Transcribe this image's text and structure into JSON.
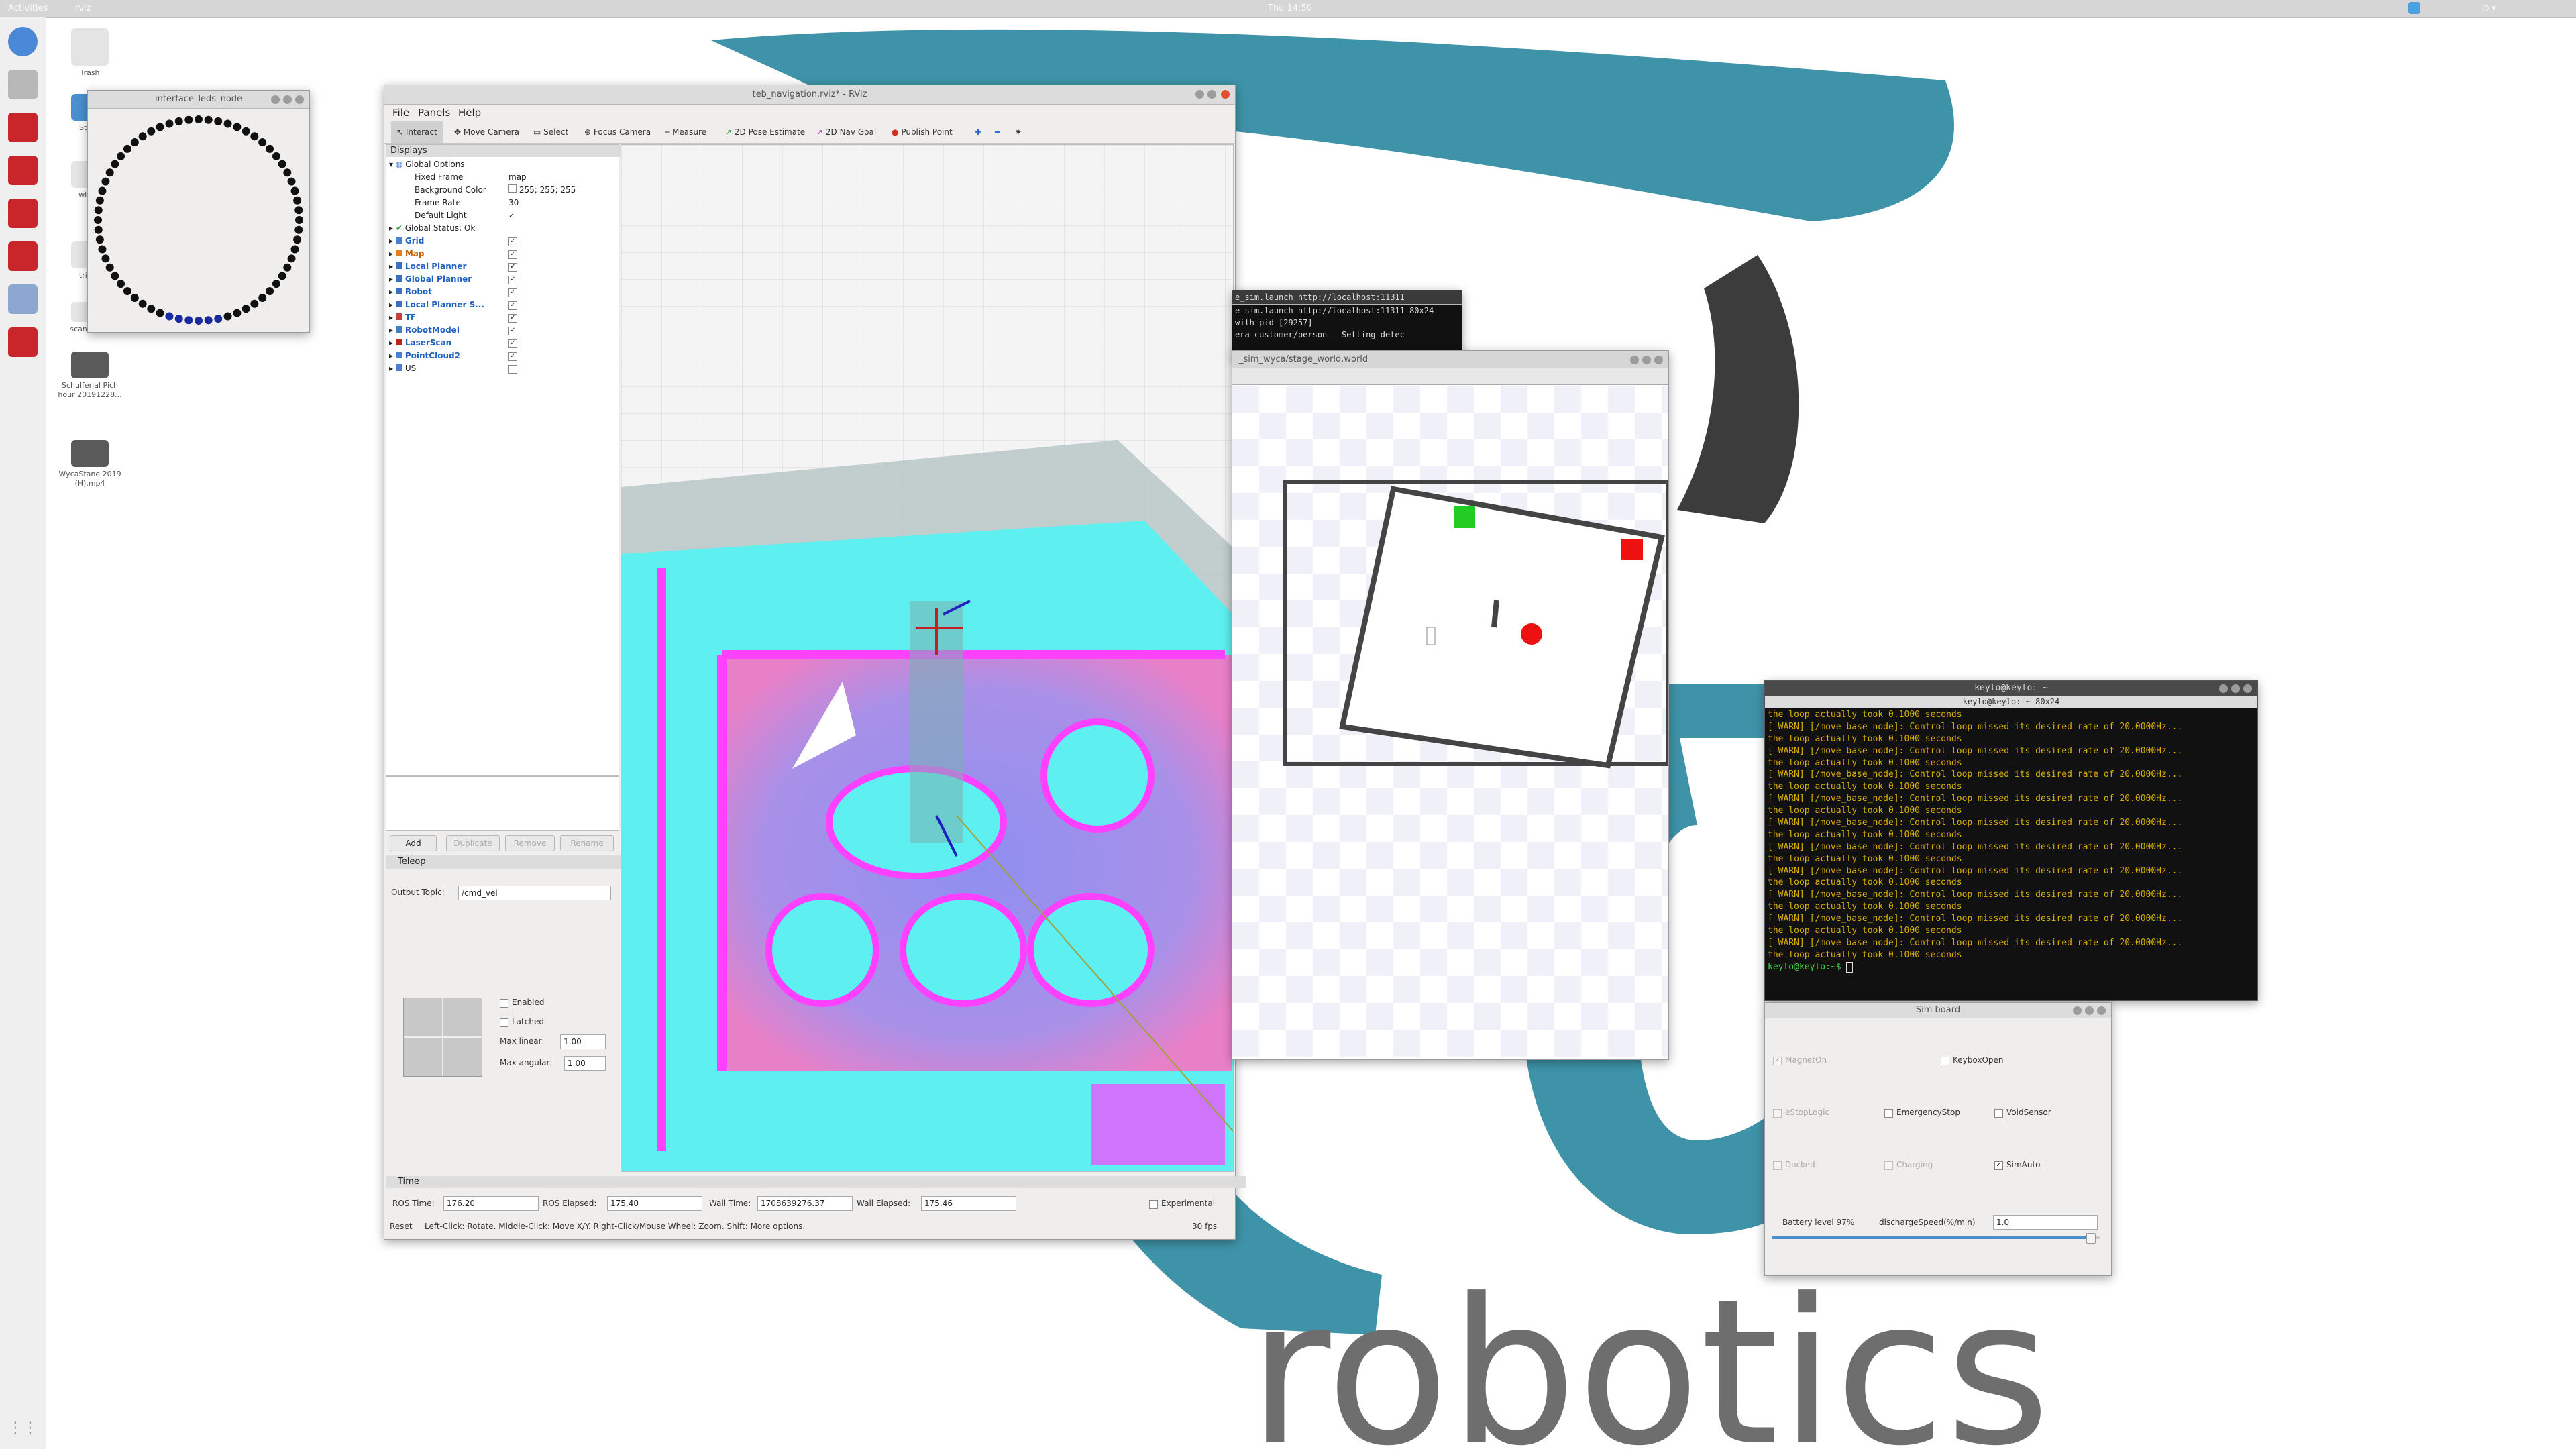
{
  "topbar": {
    "activities": "Activities",
    "app": "rviz",
    "clock": "Thu 14:50"
  },
  "desktop": {
    "icons": [
      {
        "label": "Trash"
      },
      {
        "label": "Star..."
      },
      {
        "label": "with..."
      },
      {
        "label": "trial..."
      },
      {
        "label": "scanlab.py"
      },
      {
        "label": "Schulferial Pich hour 20191228..."
      },
      {
        "label": "WycaStane 2019 (H).mp4"
      }
    ]
  },
  "leds": {
    "title": "interface_leds_node"
  },
  "rviz": {
    "title": "teb_navigation.rviz* - RViz",
    "menus": [
      "File",
      "Panels",
      "Help"
    ],
    "tools": [
      "Interact",
      "Move Camera",
      "Select",
      "Focus Camera",
      "Measure",
      "2D Pose Estimate",
      "2D Nav Goal",
      "Publish Point"
    ],
    "displays_title": "Displays",
    "global_options": "Global Options",
    "props": [
      {
        "name": "Fixed Frame",
        "value": "map"
      },
      {
        "name": "Background Color",
        "value": "255; 255; 255"
      },
      {
        "name": "Frame Rate",
        "value": "30"
      },
      {
        "name": "Default Light",
        "value": "✓"
      }
    ],
    "global_status": "Global Status: Ok",
    "displays": [
      "Grid",
      "Map",
      "Local Planner",
      "Global Planner",
      "Robot",
      "Local Planner S...",
      "TF",
      "RobotModel",
      "LaserScan",
      "PointCloud2",
      "US"
    ],
    "buttons": [
      "Add",
      "Duplicate",
      "Remove",
      "Rename"
    ],
    "teleop": {
      "title": "Teleop",
      "output_topic_label": "Output Topic:",
      "output_topic": "/cmd_vel",
      "enabled": "Enabled",
      "latched": "Latched",
      "max_linear_label": "Max linear:",
      "max_linear": "1.00",
      "max_angular_label": "Max angular:",
      "max_angular": "1.00"
    },
    "time": {
      "title": "Time",
      "ros_time_label": "ROS Time:",
      "ros_time": "176.20",
      "ros_elapsed_label": "ROS Elapsed:",
      "ros_elapsed": "175.40",
      "wall_time_label": "Wall Time:",
      "wall_time": "1708639276.37",
      "wall_elapsed_label": "Wall Elapsed:",
      "wall_elapsed": "175.46",
      "experimental": "Experimental"
    },
    "status": {
      "reset": "Reset",
      "hint": "Left-Click: Rotate. Middle-Click: Move X/Y. Right-Click/Mouse Wheel: Zoom. Shift: More options.",
      "fps": "30 fps"
    }
  },
  "small_term": {
    "title": "e_sim.launch http://localhost:11311",
    "lines": [
      "e_sim.launch http://localhost:11311 80x24",
      "with pid [29257]",
      "era_customer/person - Setting detec"
    ]
  },
  "stage": {
    "title": "_sim_wyca/stage_world.world"
  },
  "terminal": {
    "title": "keylo@keylo: ~",
    "subtitle": "keylo@keylo: ~ 80x24",
    "lines": [
      "the loop actually took 0.1000 seconds",
      "[ WARN] [/move_base_node]: Control loop missed its desired rate of 20.0000Hz...",
      "the loop actually took 0.1000 seconds",
      "[ WARN] [/move_base_node]: Control loop missed its desired rate of 20.0000Hz...",
      "the loop actually took 0.1000 seconds",
      "[ WARN] [/move_base_node]: Control loop missed its desired rate of 20.0000Hz...",
      "the loop actually took 0.1000 seconds",
      "[ WARN] [/move_base_node]: Control loop missed its desired rate of 20.0000Hz...",
      "the loop actually took 0.1000 seconds",
      "[ WARN] [/move_base_node]: Control loop missed its desired rate of 20.0000Hz...",
      "the loop actually took 0.1000 seconds",
      "[ WARN] [/move_base_node]: Control loop missed its desired rate of 20.0000Hz...",
      "the loop actually took 0.1000 seconds",
      "[ WARN] [/move_base_node]: Control loop missed its desired rate of 20.0000Hz...",
      "the loop actually took 0.1000 seconds",
      "[ WARN] [/move_base_node]: Control loop missed its desired rate of 20.0000Hz...",
      "the loop actually took 0.1000 seconds",
      "[ WARN] [/move_base_node]: Control loop missed its desired rate of 20.0000Hz...",
      "the loop actually took 0.1000 seconds",
      "[ WARN] [/move_base_node]: Control loop missed its desired rate of 20.0000Hz...",
      "the loop actually took 0.1000 seconds"
    ],
    "prompt": "keylo@keylo:~$ "
  },
  "simboard": {
    "title": "Sim board",
    "checks": [
      {
        "label": "MagnetOn",
        "checked": true,
        "disabled": true
      },
      {
        "label": "KeyboxOpen",
        "checked": false,
        "disabled": false
      },
      {
        "label": "eStopLogic",
        "checked": false,
        "disabled": true
      },
      {
        "label": "EmergencyStop",
        "checked": false,
        "disabled": false
      },
      {
        "label": "VoidSensor",
        "checked": false,
        "disabled": false
      },
      {
        "label": "Docked",
        "checked": false,
        "disabled": true
      },
      {
        "label": "Charging",
        "checked": false,
        "disabled": true
      },
      {
        "label": "SimAuto",
        "checked": true,
        "disabled": false
      }
    ],
    "battery_label": "Battery level 97%",
    "discharge_label": "dischargeSpeed(%/min)",
    "discharge_value": "1.0"
  },
  "wallpaper": {
    "word": "robotics"
  },
  "colors": {
    "accent_teal": "#3f93a8",
    "costmap_cyan": "#5ef0f0",
    "costmap_magenta": "#ff40ff",
    "costmap_violet": "#8f8ff0",
    "terminal_text": "#d8b000"
  }
}
